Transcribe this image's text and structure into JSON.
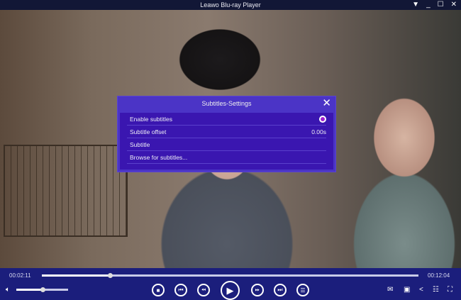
{
  "window": {
    "title": "Leawo Blu-ray Player"
  },
  "dialog": {
    "title": "Subtitles-Settings",
    "rows": [
      {
        "label": "Enable subtitles",
        "value": "",
        "enabled": true
      },
      {
        "label": "Subtitle offset",
        "value": "0.00s"
      },
      {
        "label": "Subtitle",
        "value": ""
      },
      {
        "label": "Browse for subtitles...",
        "value": ""
      }
    ]
  },
  "player": {
    "elapsed": "00:02:11",
    "total": "00:12:04",
    "progress_fraction": 0.181,
    "volume_fraction": 0.5
  },
  "colors": {
    "control_bar": "#1b1e7c",
    "dialog": "#4b34c6",
    "accent": "#a020d0"
  }
}
